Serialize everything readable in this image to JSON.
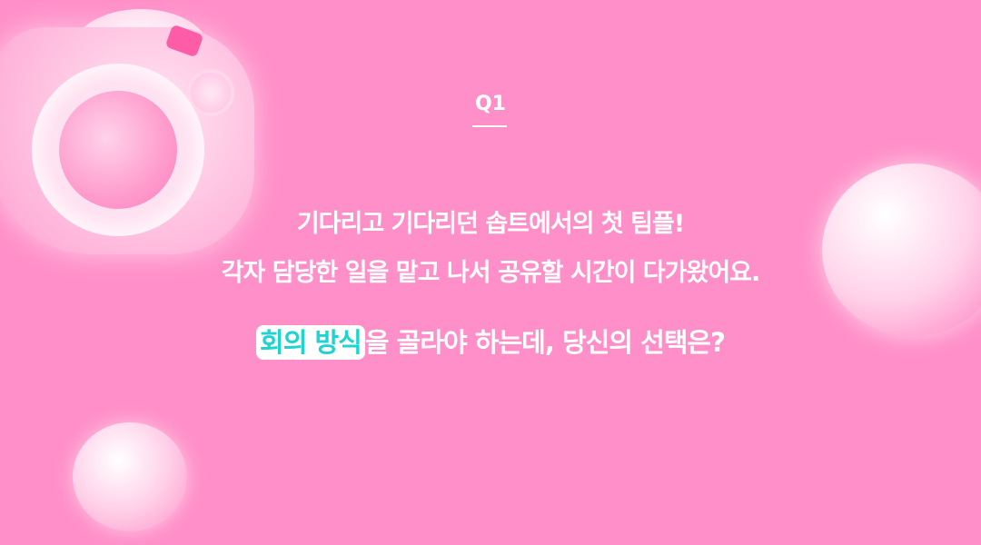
{
  "question_number": "Q1",
  "lines": [
    "기다리고 기다리던 솝트에서의 첫 팀플!",
    "각자 담당한 일을 맡고 나서 공유할 시간이 다가왔어요."
  ],
  "question": {
    "highlight": "회의 방식",
    "rest": "을 골라야 하는데, 당신의 선택은?"
  },
  "colors": {
    "background": "#ff8fc8",
    "highlight_text": "#1fd3d0"
  }
}
